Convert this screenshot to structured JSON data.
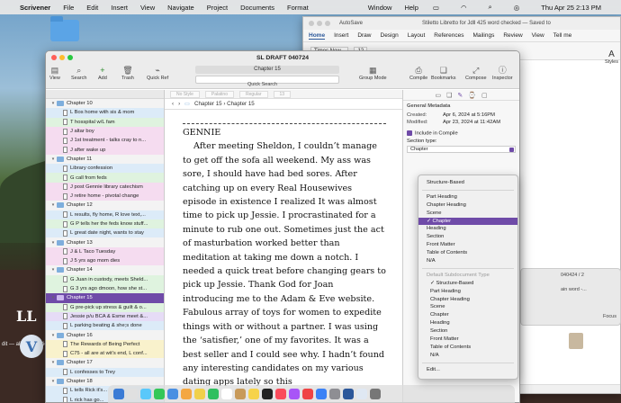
{
  "menubar": {
    "apple": "",
    "app": "Scrivener",
    "items": [
      "File",
      "Edit",
      "Insert",
      "View",
      "Navigate",
      "Project",
      "Documents",
      "Format"
    ],
    "window": "Window",
    "help": "Help",
    "clock": "Thu Apr 25  2:13 PM"
  },
  "desktop": {
    "side_label": "dit — alias_questions",
    "logo_text": "LL",
    "scrivener_backups": "scrivener backups"
  },
  "word": {
    "autosave": "AutoSave",
    "title": "Stiletto Libretto for Jdll 425 word checked — Saved to",
    "tabs": [
      "Home",
      "Insert",
      "Draw",
      "Design",
      "Layout",
      "References",
      "Mailings",
      "Review",
      "View",
      "Tell me"
    ],
    "font_name": "Times New...",
    "font_size": "12",
    "styles_label": "Styles",
    "pagebox_line1": "040424 / 2",
    "pagebox_line2": "ain word -...",
    "focus": "Focus"
  },
  "scrivener": {
    "window_title": "SL DRAFT 040724",
    "toolbar": {
      "view": "View",
      "search": "Search",
      "add": "Add",
      "trash": "Trash",
      "quick_ref": "Quick Ref",
      "chapter_field": "Chapter 15",
      "quick_search": "Quick Search",
      "group_mode": "Group Mode",
      "compile": "Compile",
      "bookmarks": "Bookmarks",
      "compose": "Compose",
      "inspector": "Inspector"
    },
    "format_bar": [
      "No Style",
      "Palatino",
      "Regular",
      "13"
    ],
    "editor_header": "Chapter 15 › Chapter 15",
    "binder": [
      {
        "type": "folder",
        "level": 1,
        "label": "Chapter 10",
        "color": ""
      },
      {
        "type": "doc",
        "level": 2,
        "label": "L Bos home with sis & mom",
        "color": "c-blue"
      },
      {
        "type": "doc",
        "level": 2,
        "label": "T hosspital w/L fam",
        "color": "c-green"
      },
      {
        "type": "doc",
        "level": 2,
        "label": "J altar boy",
        "color": "c-pink"
      },
      {
        "type": "doc",
        "level": 2,
        "label": "J 1st treatment - talks cray to n...",
        "color": "c-pink"
      },
      {
        "type": "doc",
        "level": 2,
        "label": "J after wake up",
        "color": "c-pink"
      },
      {
        "type": "folder",
        "level": 1,
        "label": "Chapter 11",
        "color": ""
      },
      {
        "type": "doc",
        "level": 2,
        "label": "Library confession",
        "color": "c-blue"
      },
      {
        "type": "doc",
        "level": 2,
        "label": "G call from feds",
        "color": "c-green"
      },
      {
        "type": "doc",
        "level": 2,
        "label": "J post Gennie library catechism",
        "color": "c-pink"
      },
      {
        "type": "doc",
        "level": 2,
        "label": "J retire home - pivotal change",
        "color": "c-pink"
      },
      {
        "type": "folder",
        "level": 1,
        "label": "Chapter 12",
        "color": ""
      },
      {
        "type": "doc",
        "level": 2,
        "label": "L results, fly home, R love text,...",
        "color": "c-blue"
      },
      {
        "type": "doc",
        "level": 2,
        "label": "G P tells her the feds know stuff...",
        "color": "c-green"
      },
      {
        "type": "doc",
        "level": 2,
        "label": "L great date night, wants to stay",
        "color": "c-blue"
      },
      {
        "type": "folder",
        "level": 1,
        "label": "Chapter 13",
        "color": ""
      },
      {
        "type": "doc",
        "level": 2,
        "label": "J & L Taco Tuesday",
        "color": "c-pink"
      },
      {
        "type": "doc",
        "level": 2,
        "label": "J 5 yrs ago mom dies",
        "color": "c-pink"
      },
      {
        "type": "folder",
        "level": 1,
        "label": "Chapter 14",
        "color": ""
      },
      {
        "type": "doc",
        "level": 2,
        "label": "G Juan in custody, meets Sheld...",
        "color": "c-green"
      },
      {
        "type": "doc",
        "level": 2,
        "label": "G 3 yrs ago dmoon, how she st...",
        "color": "c-green"
      },
      {
        "type": "folder",
        "level": 1,
        "label": "Chapter 15",
        "color": "selected"
      },
      {
        "type": "doc",
        "level": 2,
        "label": "G pre-pick up stress & guilt & o...",
        "color": "c-green"
      },
      {
        "type": "doc",
        "level": 2,
        "label": "Jessie p/u BCA  & Esme meet &...",
        "color": "c-purple"
      },
      {
        "type": "doc",
        "level": 2,
        "label": "L parking beating & she;s done",
        "color": "c-blue"
      },
      {
        "type": "folder",
        "level": 1,
        "label": "Chapter 16",
        "color": ""
      },
      {
        "type": "doc",
        "level": 2,
        "label": "The Rewards of Being Perfect",
        "color": "c-yellow"
      },
      {
        "type": "doc",
        "level": 2,
        "label": "C75 - all are at wit's end, L conf...",
        "color": "c-yellow"
      },
      {
        "type": "folder",
        "level": 1,
        "label": "Chapter 17",
        "color": ""
      },
      {
        "type": "doc",
        "level": 2,
        "label": "L confesses to Trey",
        "color": "c-blue"
      },
      {
        "type": "folder",
        "level": 1,
        "label": "Chapter 18",
        "color": ""
      },
      {
        "type": "doc",
        "level": 2,
        "label": "L tells Rick it's...",
        "color": "c-blue"
      },
      {
        "type": "doc",
        "level": 2,
        "label": "L rick has go...",
        "color": "c-blue"
      }
    ],
    "editor_text": {
      "heading": "GENNIE",
      "body": "After meeting Sheldon, I couldn’t manage to get off the sofa all weekend. My ass was sore, I should have had bed sores. After catching up on every Real Housewives episode in existence I realized It was almost time to pick up Jessie. I procrastinated for a minute to rub one out. Sometimes just the act of masturbation worked better than meditation at taking me down a notch.  I needed a quick treat before changing gears to pick up Jessie. Thank God for Joan introducing me to the Adam & Eve website. Fabulous array of toys for women to expedite things with or without a partner. I was using the ‘satisfier,’ one of my favorites. It was a best seller and I could see why. I hadn’t found any interesting candidates on my various dating apps lately so this"
    },
    "inspector": {
      "section_title": "General Metadata",
      "created_label": "Created:",
      "created": "Apr 6, 2024 at 5:16PM",
      "modified_label": "Modified:",
      "modified": "Apr 23, 2024 at 11:42AM",
      "include_compile": "Include in Compile",
      "section_type_label": "Section type:",
      "section_type_value": "Chapter"
    },
    "dropdown": {
      "items_top": [
        "Structure-Based"
      ],
      "items_main": [
        "Part Heading",
        "Chapter Heading",
        "Scene",
        "✓ Chapter",
        "Heading",
        "Section",
        "Front Matter",
        "Table of Contents",
        "N/A"
      ],
      "selected_index": 3,
      "sub_header": "Default Subdocument Type",
      "items_sub": [
        "✓ Structure-Based",
        "Part Heading",
        "Chapter Heading",
        "Scene",
        "Chapter",
        "Heading",
        "Section",
        "Front Matter",
        "Table of Contents",
        "N/A"
      ],
      "edit": "Edit..."
    }
  },
  "colors": {
    "accent": "#6f4ba8",
    "word_blue": "#2b579a"
  }
}
